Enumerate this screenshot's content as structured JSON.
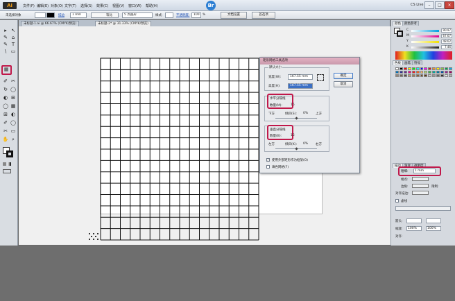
{
  "app": {
    "logo": "Ai",
    "bridge_label": "Br",
    "cslive": "CS Live",
    "window_buttons": [
      "–",
      "□",
      "×"
    ]
  },
  "menu": {
    "items": [
      "文件(F)",
      "编辑(E)",
      "对象(O)",
      "文字(T)",
      "选择(S)",
      "效果(C)",
      "视图(V)",
      "窗口(W)",
      "帮助(H)"
    ]
  },
  "control_bar": {
    "selection": "未选择对象",
    "stroke_label": "描边",
    "stroke_value": "1 mm",
    "profile_label": "等比",
    "brush_value": "5 点圆形",
    "style_label": "样式:",
    "opacity_label": "不透明度:",
    "opacity_value": "100",
    "opacity_unit": "%",
    "doc_setup": "文档设置",
    "preferences": "首选项"
  },
  "tabs": [
    {
      "label": "未标题-1.ai @ 66.67% (CMYK/预览)",
      "active": false
    },
    {
      "label": "未标题-2* @ 31.33% (CMYK/预览)",
      "active": true
    }
  ],
  "tools": [
    "▸",
    "↖",
    "✎",
    "⌂",
    "T",
    "\\",
    "▭",
    "▦",
    "✐",
    "✂",
    "◯",
    "↻",
    "⊞",
    "✋",
    "◐",
    "⌕"
  ],
  "dialog": {
    "title": "矩形网格工具选项",
    "default_size": "默认大小",
    "width_label": "宽度(W):",
    "width_value": "167.55 mm",
    "height_label": "高度(H):",
    "height_value": "167.55 mm",
    "ok": "确定",
    "cancel": "取消",
    "h_dividers": "水平分隔线",
    "h_count_label": "数量(M):",
    "h_count": "15",
    "h_bottom": "下方",
    "h_skew_label": "倾斜(S):",
    "h_skew": "0%",
    "h_top": "上方",
    "v_dividers": "垂直分隔线",
    "v_count_label": "数量(B):",
    "v_count": "15",
    "v_left": "左方",
    "v_skew_label": "倾斜(K):",
    "v_skew": "0%",
    "v_right": "右方",
    "use_outer": "使用外部矩形作为框架(O)",
    "fill_grid": "填色网格(F)"
  },
  "color_panel": {
    "tabs": [
      "颜色",
      "颜色参考"
    ],
    "channels": [
      {
        "label": "C",
        "value": "90.97",
        "unit": "%",
        "color": "#00a0e0"
      },
      {
        "label": "M",
        "value": "67.67",
        "unit": "%",
        "color": "#e0008c"
      },
      {
        "label": "Y",
        "value": "48.62",
        "unit": "%",
        "color": "#f0e000"
      },
      {
        "label": "K",
        "value": "7.46",
        "unit": "%",
        "color": "#222222"
      }
    ]
  },
  "swatches_panel": {
    "tabs": [
      "色板",
      "画笔",
      "符号"
    ],
    "colors": [
      "#ffffff",
      "#000000",
      "#ff0000",
      "#ffff00",
      "#00ff00",
      "#00ffff",
      "#0000ff",
      "#ff00ff",
      "#c8102e",
      "#f7941d",
      "#fff200",
      "#8dc63f",
      "#00a651",
      "#00aeef",
      "#0072bc",
      "#2e3192",
      "#662d91",
      "#ec008c",
      "#ed1c24",
      "#f26522",
      "#fbaf5d",
      "#acd373",
      "#39b54a",
      "#00a99d",
      "#0076a3",
      "#0054a6",
      "#92278f",
      "#9e005d",
      "#998675",
      "#736357",
      "#534741",
      "#c69c6d",
      "#a67c52",
      "#8c6239",
      "#754c24",
      "#603913",
      "#cccccc",
      "#999999",
      "#666666",
      "#333333",
      "#e6e6e6",
      "#b3b3b3"
    ]
  },
  "stroke_panel": {
    "tabs": [
      "描边",
      "渐变",
      "透明度"
    ],
    "weight_label": "粗细:",
    "weight_value": "1 mm",
    "cap_label": "端点:",
    "corner_label": "边角:",
    "limit_label": "限制:",
    "align_label": "对齐描边:",
    "dash_label": "虚线",
    "arrow_label": "箭头:",
    "scale_label": "缩放:",
    "scale_value": "100%",
    "align2_label": "对齐:"
  },
  "grid": {
    "rows": 16,
    "cols": 16
  }
}
